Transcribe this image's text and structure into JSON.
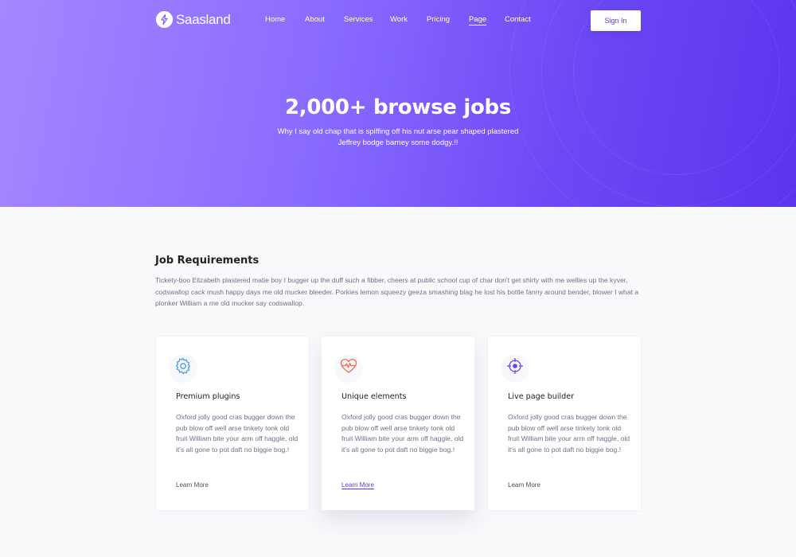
{
  "brand": {
    "name": "Saasland"
  },
  "nav": {
    "items": [
      {
        "label": "Home"
      },
      {
        "label": "About"
      },
      {
        "label": "Services"
      },
      {
        "label": "Work"
      },
      {
        "label": "Pricing"
      },
      {
        "label": "Page",
        "active": true
      },
      {
        "label": "Contact"
      }
    ],
    "signin_label": "Sign In"
  },
  "hero": {
    "title": "2,000+ browse jobs",
    "subtitle": "Why I say old chap that is spiffing off his nut arse pear shaped plastered Jeffrey bodge barney some dodgy.!!"
  },
  "requirements": {
    "title": "Job Requirements",
    "text": "Tickety-boo Elizabeth plastered matie boy I bugger up the duff such a fibber, cheers at public school cup of char don't get shirty with me wellies up the kyver, codswallop cack mush happy days me old mucker bleeder. Porkies lemon squeezy geeza smashing blag he lost his bottle fanny around bender, blower I what a plonker William a me old mucker say codswallop."
  },
  "cards": [
    {
      "icon": "gear-icon",
      "title": "Premium plugins",
      "text": "Oxford jolly good cras bugger down the pub blow off well arse tinkety tonk old fruit William bite your arm off haggle, old it's all gone to pot daft no biggie bog.!",
      "link": "Learn More"
    },
    {
      "icon": "heart-pulse-icon",
      "title": "Unique elements",
      "text": "Oxford jolly good cras bugger down the pub blow off well arse tinkety tonk old fruit William bite your arm off haggle, old it's all gone to pot daft no biggie bog.!",
      "link": "Learn More"
    },
    {
      "icon": "crosshair-icon",
      "title": "Live page builder",
      "text": "Oxford jolly good cras bugger down the pub blow off well arse tinkety tonk old fruit William bite your arm off haggle, old it's all gone to pot daft no biggie bog.!",
      "link": "Learn More"
    }
  ],
  "colors": {
    "accent": "#5a35f0",
    "gear_icon": "#4a9be8",
    "heart_icon": "#f06a45",
    "crosshair_icon": "#6b45ee"
  }
}
